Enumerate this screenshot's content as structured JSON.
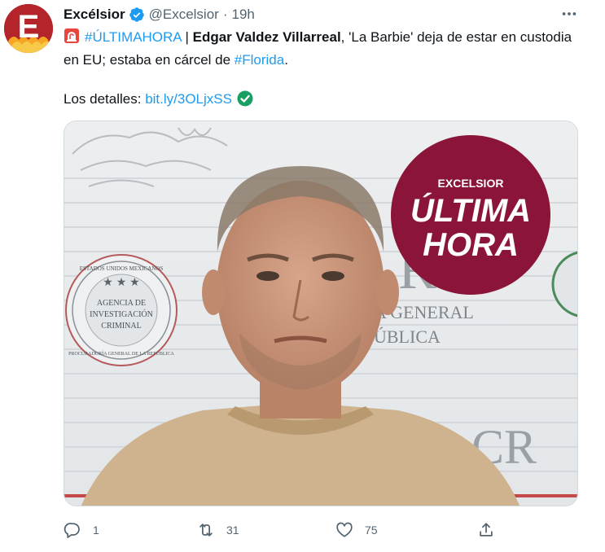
{
  "tweet": {
    "author": {
      "display_name": "Excélsior",
      "handle": "@Excelsior",
      "avatar_letter": "E",
      "verified": true
    },
    "separator": "·",
    "time": "19h",
    "text": {
      "hashtag_breaking": "#ÚLTIMAHORA",
      "pipe": "|",
      "bold_name": "Edgar Valdez Villarreal",
      "part1": ", 'La Barbie' deja de estar en custodia en EU; estaba en cárcel de ",
      "hashtag_place": "#Florida",
      "part2": ".",
      "details_label": "Los detalles:",
      "link": "bit.ly/3OLjxSS"
    },
    "media": {
      "badge_brand": "EXCELSIOR",
      "badge_line1": "ÚLTIMA",
      "badge_line2": "HORA",
      "seal_top": "ESTADOS UNIDOS MEXICANOS",
      "seal_line1": "AGENCIA DE",
      "seal_line2": "INVESTIGACIÓN",
      "seal_line3": "CRIMINAL",
      "seal_bottom": "PROCURADURÍA GENERAL DE LA REPÚBLICA",
      "wall_text1": "A GENERAL",
      "wall_text2": "ÚBLICA",
      "wall_letters_top": "R",
      "wall_letters_bottom": "CR"
    },
    "actions": {
      "replies": "1",
      "retweets": "31",
      "likes": "75"
    }
  },
  "colors": {
    "accent": "#1d9bf0",
    "muted": "#536471",
    "brand_red": "#b3252a",
    "badge_maroon": "#8a1538",
    "verified": "#1d9bf0",
    "check_emoji": "#1a9f63"
  }
}
